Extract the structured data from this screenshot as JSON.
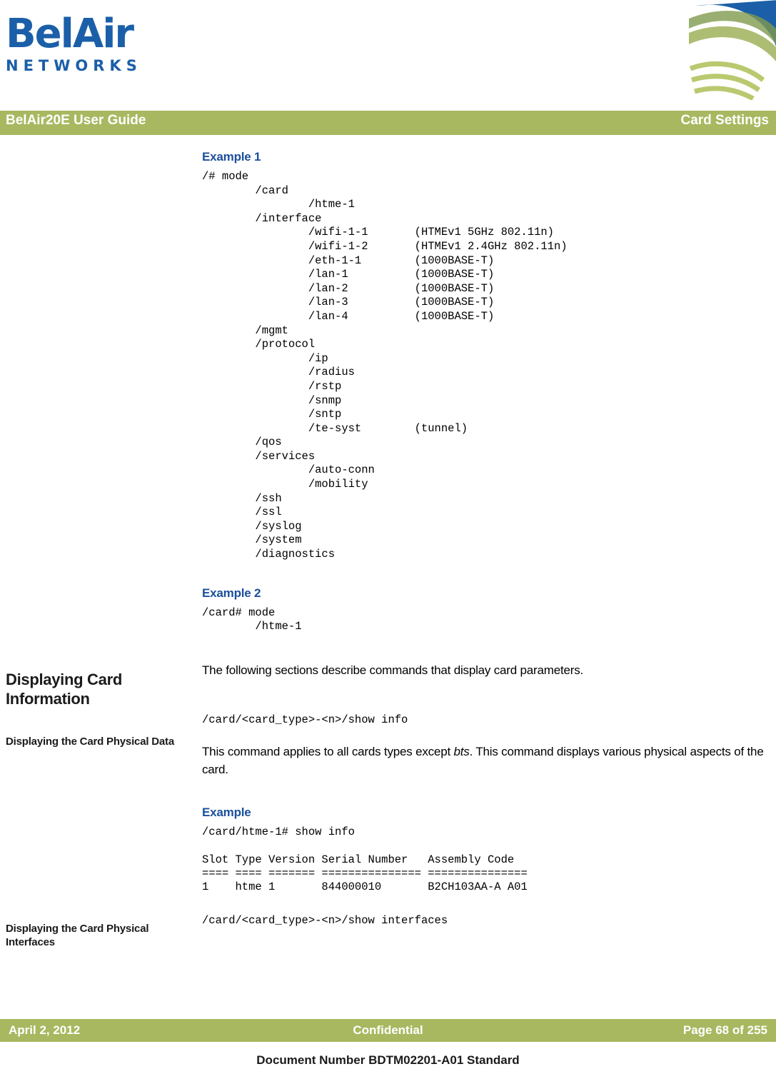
{
  "logo": {
    "word": "BelAir",
    "sub": "NETWORKS",
    "color": "#1b5fa8"
  },
  "header": {
    "left": "BelAir20E User Guide",
    "right": "Card Settings",
    "bar_color": "#a8b860",
    "text_color": "#ffffff"
  },
  "sections": {
    "example1_heading": "Example 1",
    "example1_code": "/# mode\n        /card\n                /htme-1\n        /interface\n                /wifi-1-1       (HTMEv1 5GHz 802.11n)\n                /wifi-1-2       (HTMEv1 2.4GHz 802.11n)\n                /eth-1-1        (1000BASE-T)\n                /lan-1          (1000BASE-T)\n                /lan-2          (1000BASE-T)\n                /lan-3          (1000BASE-T)\n                /lan-4          (1000BASE-T)\n        /mgmt\n        /protocol\n                /ip\n                /radius\n                /rstp\n                /snmp\n                /sntp\n                /te-syst        (tunnel)\n        /qos\n        /services\n                /auto-conn\n                /mobility\n        /ssh\n        /ssl\n        /syslog\n        /system\n        /diagnostics",
    "example2_heading": "Example 2",
    "example2_code": "/card# mode\n        /htme-1",
    "displaying_card_information_heading": "Displaying Card Information",
    "displaying_card_information_body": "The following sections describe commands that display card parameters.",
    "displaying_physical_data_heading": "Displaying the Card Physical Data",
    "displaying_physical_data_command": "/card/<card_type>-<n>/show info",
    "displaying_physical_data_body_1": "This command applies to all cards types except ",
    "displaying_physical_data_body_italic": "bts",
    "displaying_physical_data_body_2": ". This command displays various physical aspects of the card.",
    "example3_heading": "Example",
    "example3_code": "/card/htme-1# show info\n\nSlot Type Version Serial Number   Assembly Code\n==== ==== ======= =============== ===============\n1    htme 1       844000010       B2CH103AA-A A01",
    "displaying_physical_interfaces_heading": "Displaying the Card Physical Interfaces",
    "displaying_physical_interfaces_command": "/card/<card_type>-<n>/show interfaces"
  },
  "footer": {
    "date": "April 2, 2012",
    "center": "Confidential",
    "page": "Page 68 of 255",
    "document": "Document Number BDTM02201-A01 Standard"
  }
}
